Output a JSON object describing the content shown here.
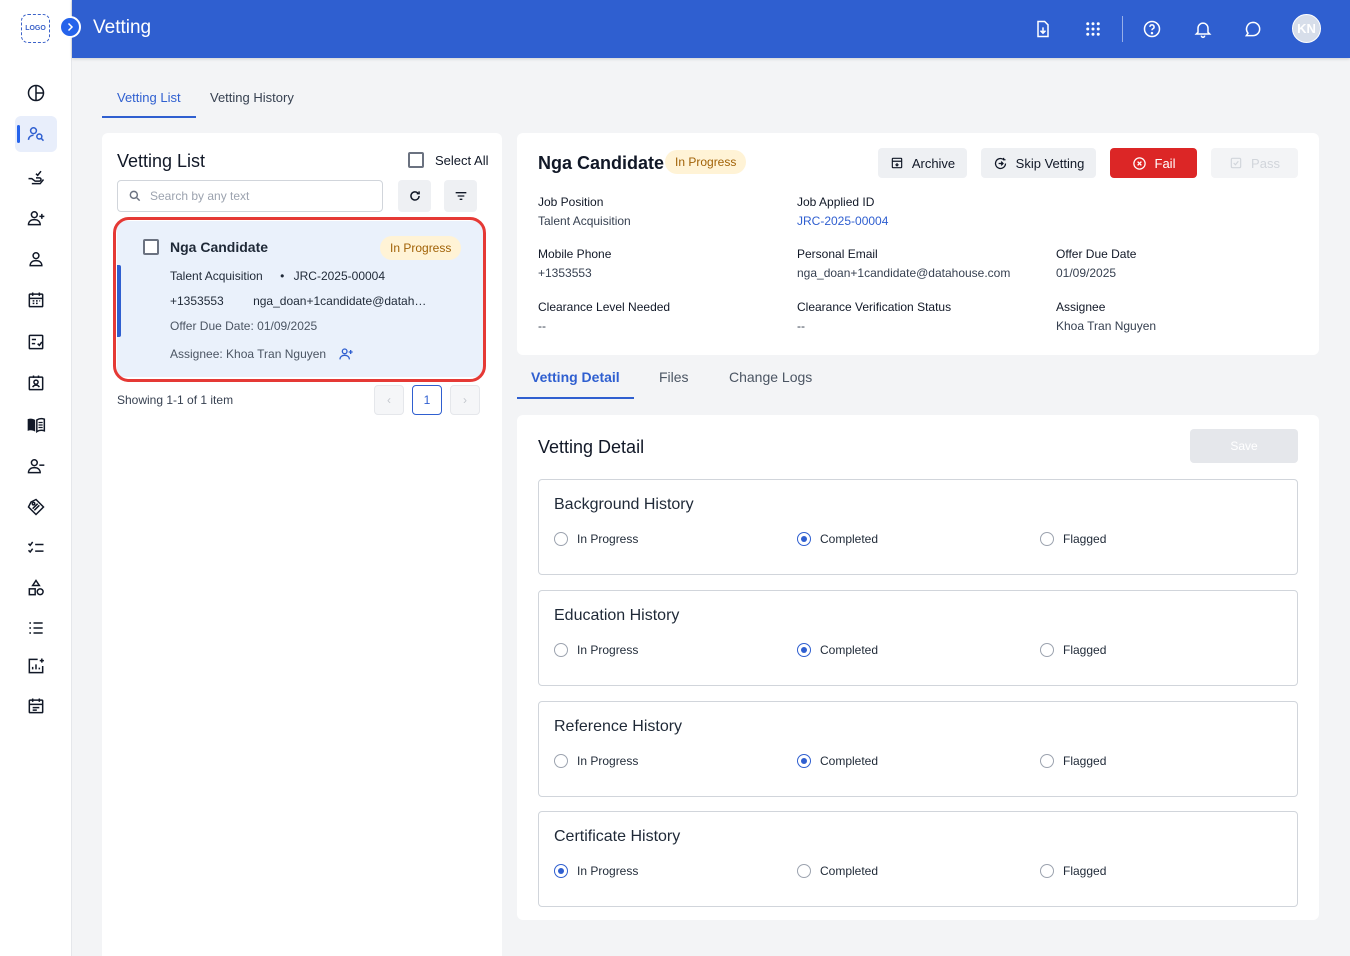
{
  "app": {
    "logo_text": "LOGO",
    "page_title": "Vetting",
    "avatar_initials": "KN"
  },
  "rail_icons": [
    "dashboard-icon",
    "vetting-icon",
    "onboarding-icon",
    "add-user-icon",
    "person-icon",
    "calendar-icon",
    "checklist-doc-icon",
    "id-card-icon",
    "handbook-icon",
    "remove-user-icon",
    "tag-icon",
    "task-list-icon",
    "shapes-icon",
    "list-icon",
    "report-icon",
    "schedule-icon"
  ],
  "top_tabs": [
    "Vetting List",
    "Vetting History"
  ],
  "list": {
    "title": "Vetting List",
    "select_all": "Select All",
    "search_placeholder": "Search by any text",
    "card": {
      "name": "Nga Candidate",
      "status": "In Progress",
      "position": "Talent Acquisition",
      "bullet": "•",
      "job_id": "JRC-2025-00004",
      "phone": "+1353553",
      "email": "nga_doan+1candidate@datah…",
      "offer_due": "Offer Due Date: 01/09/2025",
      "assignee": "Assignee: Khoa Tran Nguyen"
    },
    "showing": "Showing 1-1 of 1 item",
    "current_page": "1",
    "prev": "‹",
    "next": "›"
  },
  "detail": {
    "name": "Nga Candidate",
    "status": "In Progress",
    "actions": {
      "archive": "Archive",
      "skip": "Skip Vetting",
      "fail": "Fail",
      "pass": "Pass"
    },
    "fields": {
      "job_position_label": "Job Position",
      "job_position": "Talent Acquisition",
      "job_applied_id_label": "Job Applied ID",
      "job_applied_id": "JRC-2025-00004",
      "mobile_label": "Mobile Phone",
      "mobile": "+1353553",
      "email_label": "Personal Email",
      "email": "nga_doan+1candidate@datahouse.com",
      "offer_due_label": "Offer Due Date",
      "offer_due": "01/09/2025",
      "clearance_level_label": "Clearance Level Needed",
      "clearance_level": "--",
      "clearance_status_label": "Clearance Verification Status",
      "clearance_status": "--",
      "assignee_label": "Assignee",
      "assignee": "Khoa Tran Nguyen"
    }
  },
  "detail_tabs": [
    "Vetting Detail",
    "Files",
    "Change Logs"
  ],
  "form": {
    "title": "Vetting Detail",
    "save": "Save",
    "options": [
      "In Progress",
      "Completed",
      "Flagged"
    ],
    "sections": [
      {
        "title": "Background History",
        "selected": "Completed"
      },
      {
        "title": "Education History",
        "selected": "Completed"
      },
      {
        "title": "Reference History",
        "selected": "Completed"
      },
      {
        "title": "Certificate History",
        "selected": "In Progress"
      }
    ]
  },
  "colors": {
    "primary": "#2f5fd0",
    "fail": "#dc2626",
    "badge_bg": "#fff3d6",
    "badge_text": "#a16207",
    "highlight": "#e53935"
  }
}
